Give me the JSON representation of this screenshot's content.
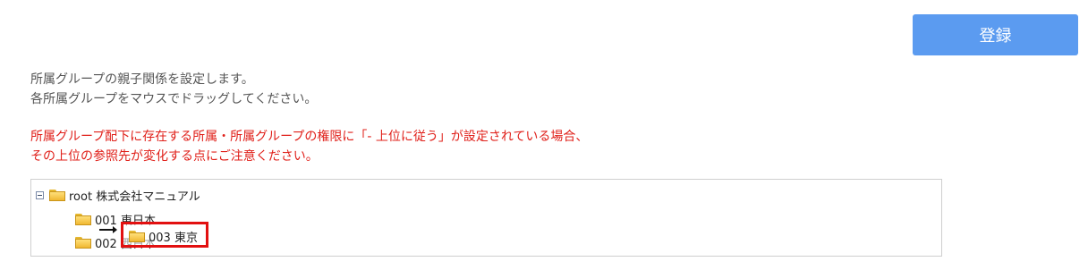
{
  "toolbar": {
    "register_label": "登録"
  },
  "description": {
    "line1": "所属グループの親子関係を設定します。",
    "line2": "各所属グループをマウスでドラッグしてください。"
  },
  "warning": {
    "line1": "所属グループ配下に存在する所属・所属グループの権限に「- 上位に従う」が設定されている場合、",
    "line2": "その上位の参照先が変化する点にご注意ください。",
    "color": "#e0201a"
  },
  "tree": {
    "root_label": "root 株式会社マニュアル",
    "children": [
      {
        "label": "001 東日本"
      },
      {
        "label": "002 西日本"
      }
    ],
    "dragging_label": "003 東京"
  },
  "colors": {
    "accent": "#5b9bf0",
    "highlight_border": "#e21010"
  }
}
